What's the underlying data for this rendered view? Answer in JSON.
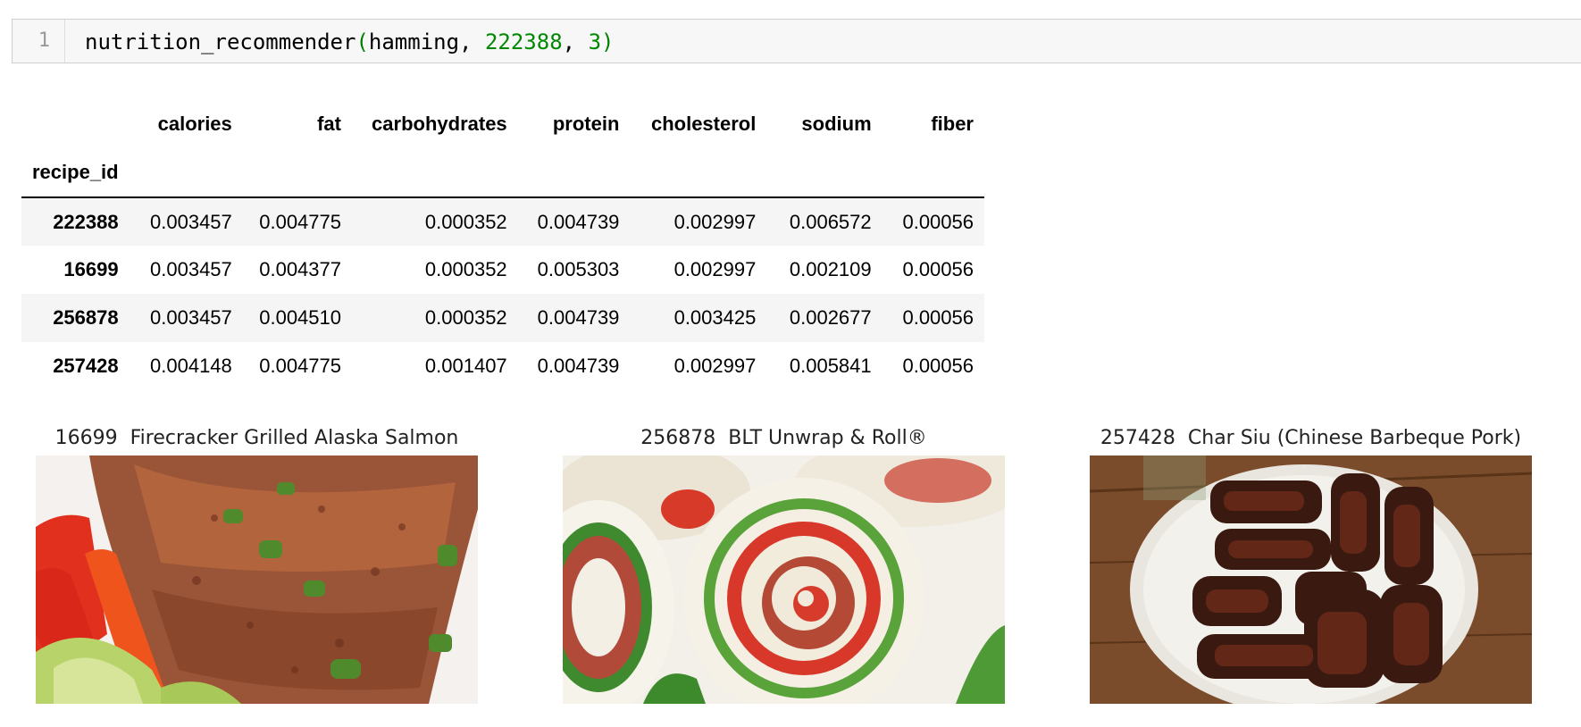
{
  "cell": {
    "line_number": "1",
    "code": {
      "func": "nutrition_recommender",
      "open": "(",
      "arg1": "hamming",
      "sep1": ", ",
      "arg2": "222388",
      "sep2": ", ",
      "arg3": "3",
      "close": ")"
    }
  },
  "dataframe": {
    "index_name": "recipe_id",
    "columns": [
      "calories",
      "fat",
      "carbohydrates",
      "protein",
      "cholesterol",
      "sodium",
      "fiber"
    ],
    "rows": [
      {
        "id": "222388",
        "values": [
          "0.003457",
          "0.004775",
          "0.000352",
          "0.004739",
          "0.002997",
          "0.006572",
          "0.00056"
        ]
      },
      {
        "id": "16699",
        "values": [
          "0.003457",
          "0.004377",
          "0.000352",
          "0.005303",
          "0.002997",
          "0.002109",
          "0.00056"
        ]
      },
      {
        "id": "256878",
        "values": [
          "0.003457",
          "0.004510",
          "0.000352",
          "0.004739",
          "0.003425",
          "0.002677",
          "0.00056"
        ]
      },
      {
        "id": "257428",
        "values": [
          "0.004148",
          "0.004775",
          "0.001407",
          "0.004739",
          "0.002997",
          "0.005841",
          "0.00056"
        ]
      }
    ]
  },
  "recommendations": [
    {
      "id": "16699",
      "name": "Firecracker Grilled Alaska Salmon"
    },
    {
      "id": "256878",
      "name": "BLT Unwrap & Roll®"
    },
    {
      "id": "257428",
      "name": "Char Siu (Chinese Barbeque Pork)"
    }
  ]
}
